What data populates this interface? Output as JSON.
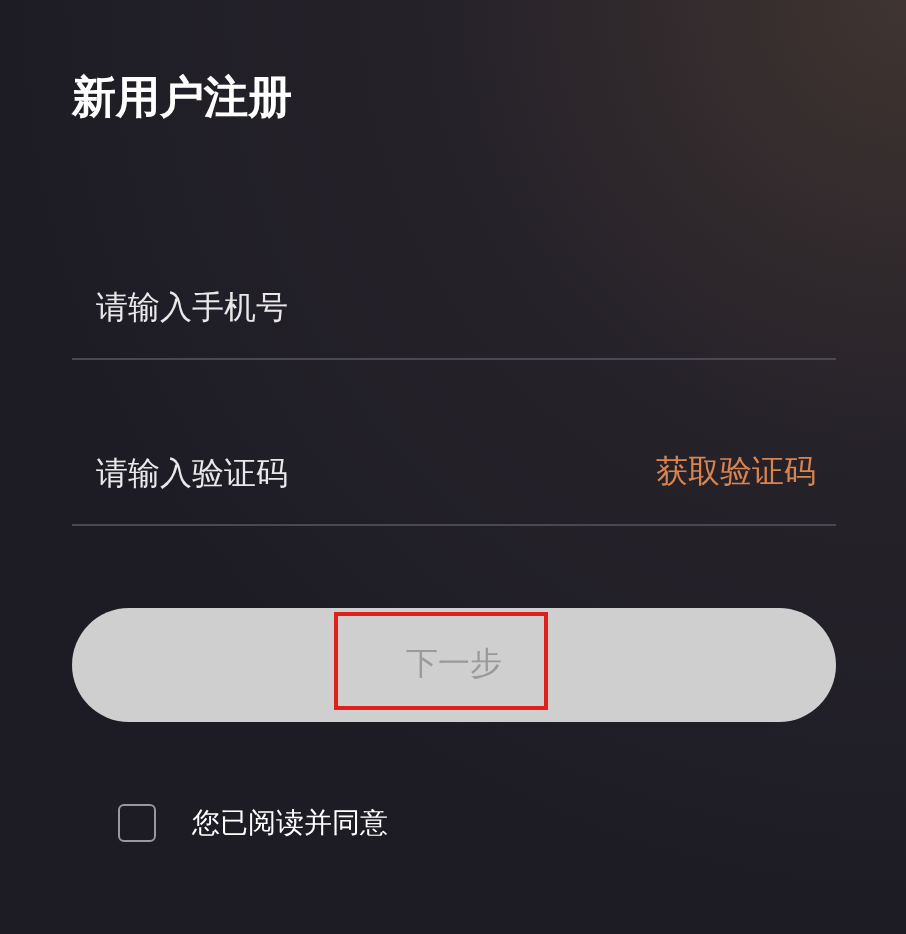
{
  "title": "新用户注册",
  "fields": [
    {
      "placeholder": "请输入手机号"
    },
    {
      "placeholder": "请输入验证码",
      "action": "获取验证码"
    }
  ],
  "next_button": {
    "label": "下一步",
    "disabled": true,
    "annotated": true
  },
  "agreement": {
    "checked": false,
    "text": "您已阅读并同意"
  }
}
